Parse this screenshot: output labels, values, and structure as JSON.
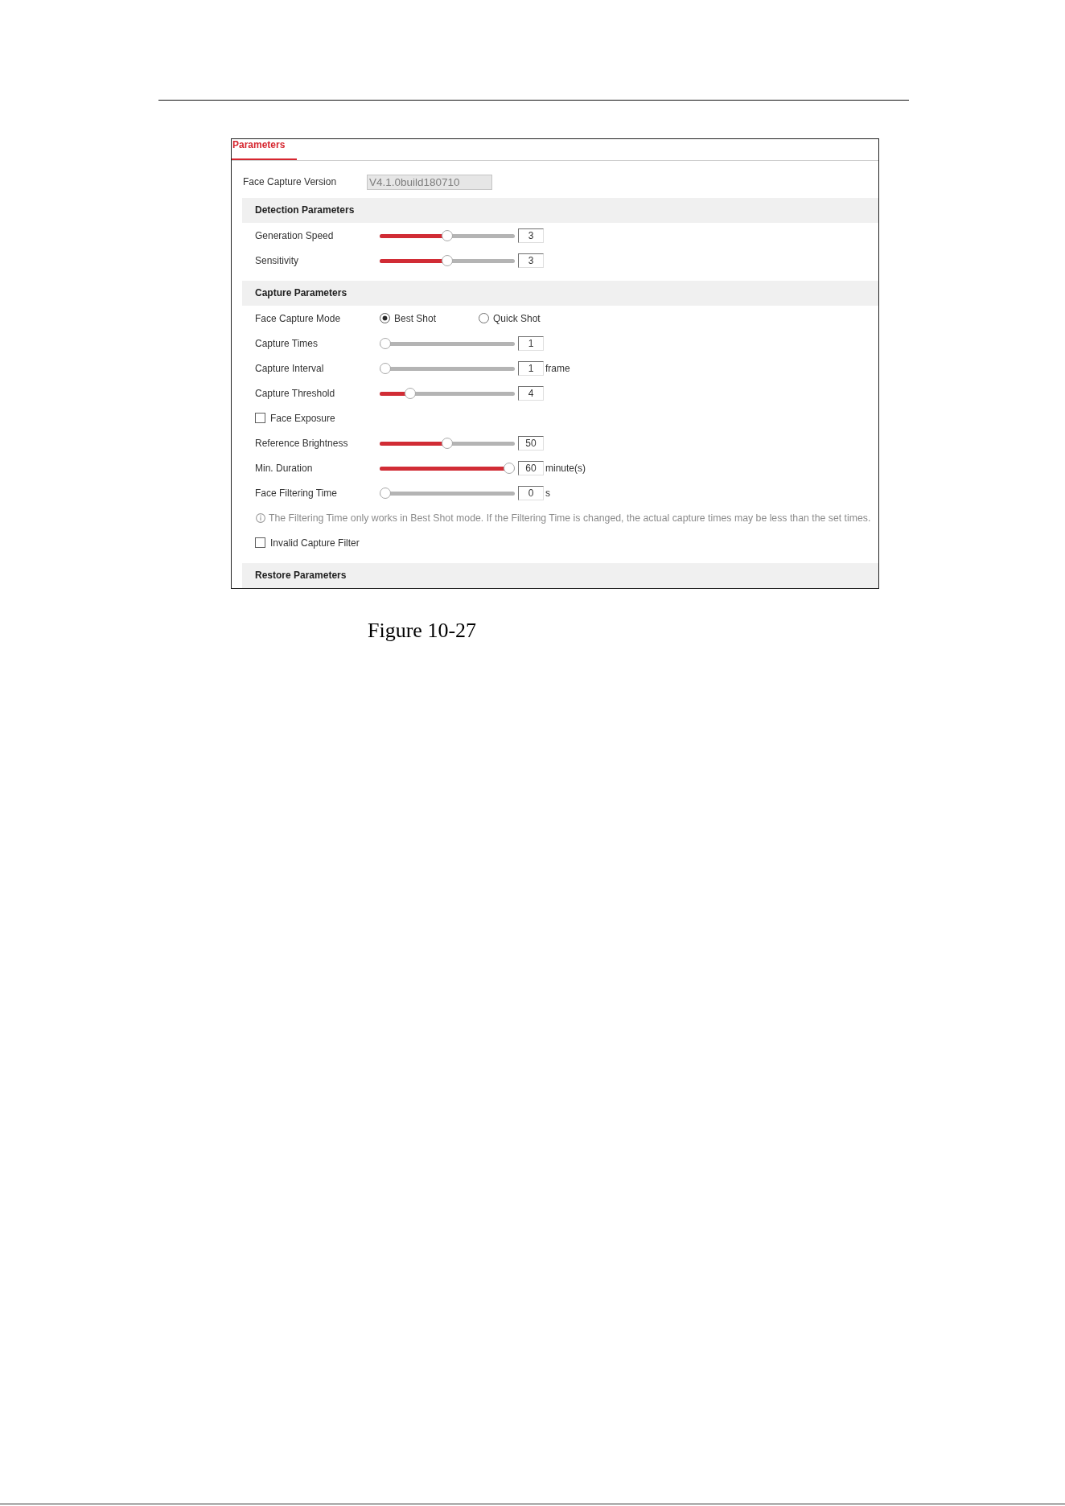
{
  "tabs": [
    {
      "label": "Parameters",
      "selected": true
    }
  ],
  "version": {
    "label": "Face Capture Version",
    "value": "V4.1.0build180710",
    "disabled": true
  },
  "sections": [
    {
      "title": "Detection Parameters",
      "rows": [
        {
          "kind": "slider",
          "label": "Generation Speed",
          "level": 0.5,
          "value": "3"
        },
        {
          "kind": "slider",
          "label": "Sensitivity",
          "level": 0.5,
          "value": "3"
        }
      ]
    },
    {
      "title": "Capture Parameters",
      "rows": [
        {
          "kind": "radio",
          "label": "Face Capture Mode",
          "options": [
            {
              "label": "Best Shot",
              "selected": true
            },
            {
              "label": "Quick Shot",
              "selected": false
            }
          ]
        },
        {
          "kind": "slider",
          "label": "Capture Times",
          "level": 0,
          "value": "1"
        },
        {
          "kind": "slider",
          "label": "Capture Interval",
          "level": 0,
          "value": "1",
          "unit": "frame"
        },
        {
          "kind": "slider",
          "label": "Capture Threshold",
          "level": 0.2,
          "value": "4"
        },
        {
          "kind": "checkbox",
          "label": "Face Exposure",
          "checked": false
        },
        {
          "kind": "slider",
          "label": "Reference Brightness",
          "level": 0.5,
          "value": "50"
        },
        {
          "kind": "slider",
          "label": "Min. Duration",
          "level": 1,
          "value": "60",
          "unit": "minute(s)"
        },
        {
          "kind": "slider",
          "label": "Face Filtering Time",
          "level": 0,
          "value": "0",
          "unit": "s"
        },
        {
          "kind": "note",
          "text": "The Filtering Time only works in Best Shot mode. If the Filtering Time is changed, the actual capture times may be less than the set times."
        },
        {
          "kind": "checkbox",
          "label": "Invalid Capture Filter",
          "checked": false
        }
      ]
    },
    {
      "title": "Restore Parameters"
    }
  ],
  "caption": "Figure 10-27"
}
